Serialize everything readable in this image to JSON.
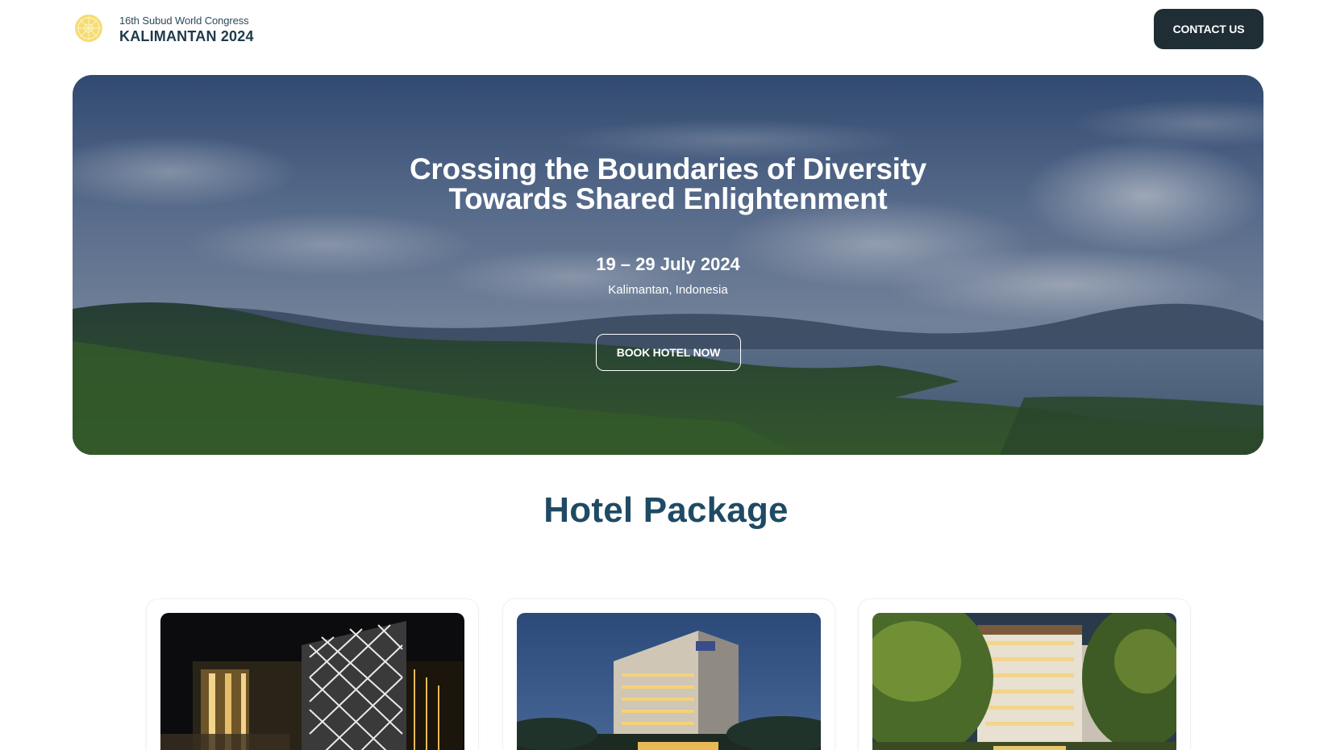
{
  "header": {
    "logo_icon": "subud-emblem-icon",
    "brand_subtitle": "16th Subud World Congress",
    "brand_title": "KALIMANTAN 2024",
    "contact_label": "CONTACT US"
  },
  "hero": {
    "title_line1": "Crossing the Boundaries of Diversity",
    "title_line2": "Towards Shared Enlightenment",
    "date": "19 – 29 July 2024",
    "location": "Kalimantan, Indonesia",
    "book_label": "BOOK HOTEL NOW"
  },
  "hotel_section": {
    "title": "Hotel Package",
    "cards": [
      {
        "image": "hotel-night-facade-image"
      },
      {
        "image": "hotel-dusk-building-image"
      },
      {
        "image": "hotel-tropical-garden-image"
      }
    ]
  },
  "colors": {
    "primary_dark": "#1f2d35",
    "heading_blue": "#1f4a63",
    "logo_gold": "#f2d25c"
  }
}
